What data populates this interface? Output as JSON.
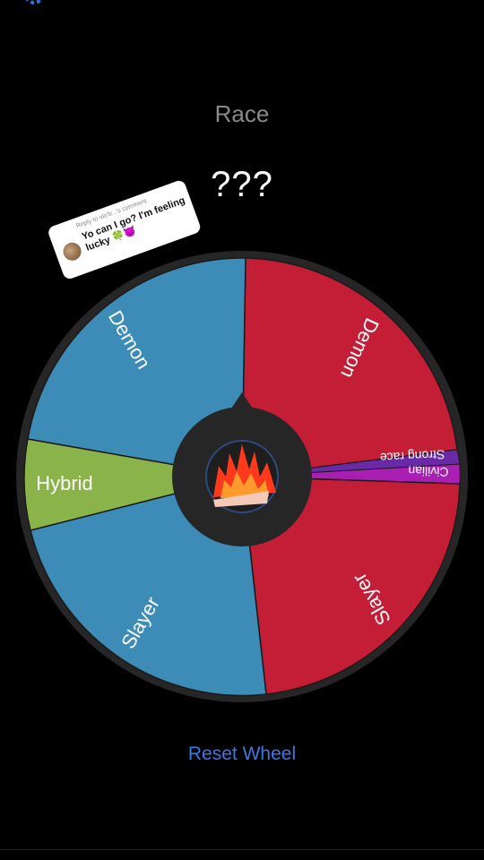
{
  "header": {
    "title": "Race",
    "result": "???"
  },
  "wheel": {
    "center_icon": "fire-icon",
    "segments": [
      {
        "label": "Demon",
        "color": "#c41d36"
      },
      {
        "label": "Strong race",
        "color": "#6a2aa8"
      },
      {
        "label": "Civilian",
        "color": "#a91eb3"
      },
      {
        "label": "Slayer",
        "color": "#c41d36"
      },
      {
        "label": "Slayer",
        "color": "#3d8cb8"
      },
      {
        "label": "Hybrid",
        "color": "#8ab34a"
      },
      {
        "label": "Demon",
        "color": "#3d8cb8"
      }
    ]
  },
  "comment_bubble": {
    "reply_to": "Reply to vlo'b...'s comment",
    "message": "Yo can I go? I'm feeling lucky 🍀😈"
  },
  "actions": {
    "reset_label": "Reset Wheel"
  },
  "colors": {
    "accent": "#3b78e7",
    "rim": "#262626",
    "hub": "#262626"
  }
}
